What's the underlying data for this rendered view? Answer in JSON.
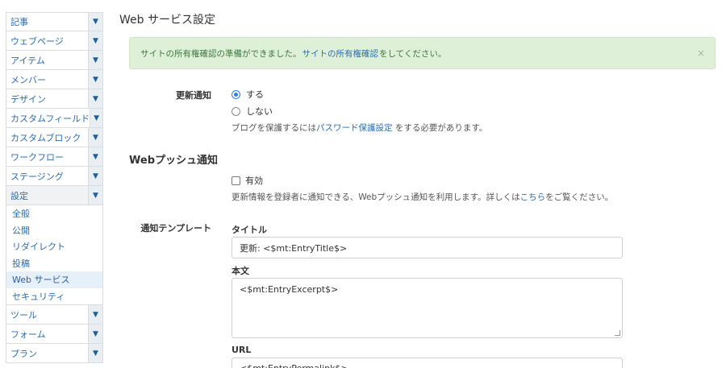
{
  "sidebar": {
    "items_top": [
      {
        "label": "記事"
      },
      {
        "label": "ウェブページ"
      },
      {
        "label": "アイテム"
      },
      {
        "label": "メンバー"
      },
      {
        "label": "デザイン"
      },
      {
        "label": "カスタムフィールド"
      },
      {
        "label": "カスタムブロック"
      },
      {
        "label": "ワークフロー"
      },
      {
        "label": "ステージング"
      },
      {
        "label": "設定"
      }
    ],
    "submenu": [
      {
        "label": "全般"
      },
      {
        "label": "公開"
      },
      {
        "label": "リダイレクト"
      },
      {
        "label": "投稿"
      },
      {
        "label": "Web サービス"
      },
      {
        "label": "セキュリティ"
      }
    ],
    "items_bottom": [
      {
        "label": "ツール"
      },
      {
        "label": "フォーム"
      },
      {
        "label": "プラン"
      }
    ],
    "arrow_glyph": "▼"
  },
  "page": {
    "title": "Web サービス設定"
  },
  "alert": {
    "text_before": "サイトの所有権確認の準備ができました。",
    "link": "サイトの所有権確認",
    "text_after": "をしてください。",
    "close": "×"
  },
  "update_notify": {
    "label": "更新通知",
    "option_yes": "する",
    "option_no": "しない",
    "hint_before": "ブログを保護するには",
    "hint_link": "パスワード保護設定",
    "hint_after": " をする必要があります。"
  },
  "web_push": {
    "section_title": "Webプッシュ通知",
    "checkbox_label": "有効",
    "hint_before": "更新情報を登録者に通知できる、Webプッシュ通知を利用します。詳しくは",
    "hint_link": "こちら",
    "hint_after": "をご覧ください。"
  },
  "template": {
    "label": "通知テンプレート",
    "title_label": "タイトル",
    "title_value": "更新: <$mt:EntryTitle$>",
    "body_label": "本文",
    "body_value": "<$mt:EntryExcerpt$>",
    "url_label": "URL",
    "url_value": "<$mt:EntryPermalink$>"
  }
}
